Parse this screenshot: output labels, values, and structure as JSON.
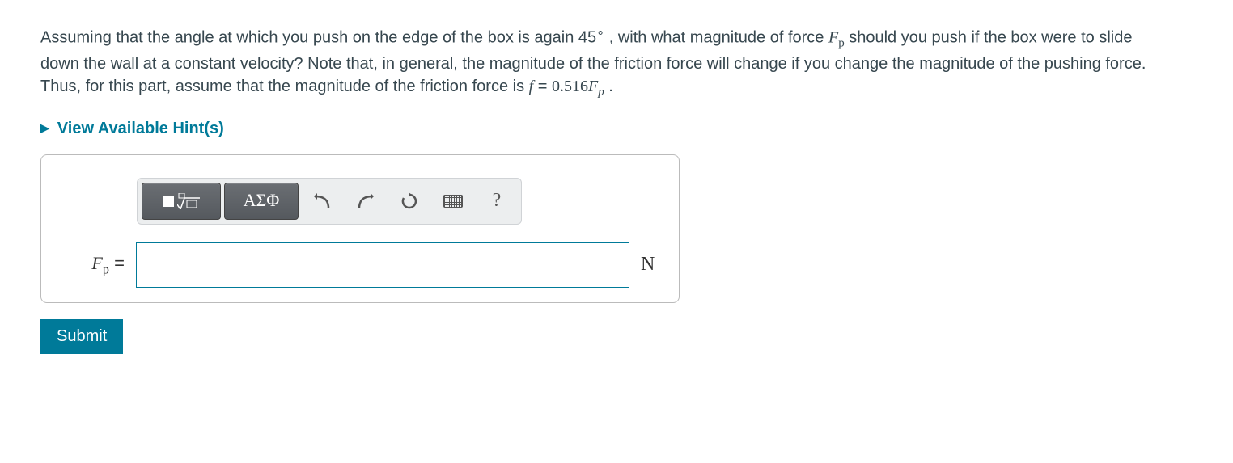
{
  "question": {
    "pre": "Assuming that the angle at which you push on the edge of the box is again 45",
    "deg": "∘",
    "mid1": " , with what magnitude of force ",
    "var1_base": "F",
    "var1_sub": "p",
    "mid2": " should you push if the box were to slide down the wall at a constant velocity? Note that, in general, the magnitude of the friction force will change if you change the magnitude of the pushing force. Thus, for this part, assume that the magnitude of the friction force is ",
    "eq_lhs": "f",
    "eq_eq": " = ",
    "eq_coeff": "0.516",
    "eq_rhs_base": "F",
    "eq_rhs_sub": "p",
    "period": " ."
  },
  "hints_label": "View Available Hint(s)",
  "toolbar": {
    "greek_label": "ΑΣΦ",
    "help_label": "?"
  },
  "answer": {
    "var_base": "F",
    "var_sub": "p",
    "equals": " = ",
    "value": "",
    "unit": "N"
  },
  "submit_label": "Submit"
}
